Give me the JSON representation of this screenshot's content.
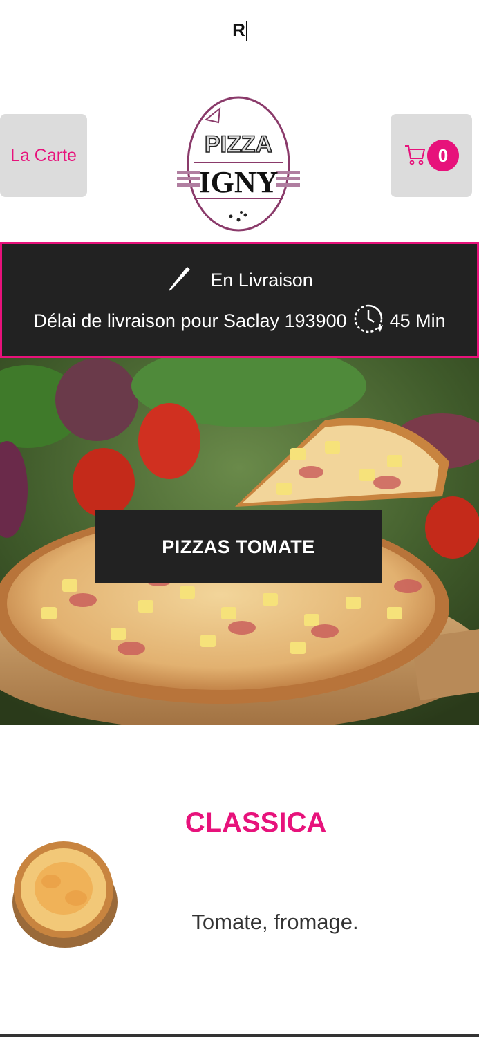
{
  "search": {
    "value": "R"
  },
  "header": {
    "carte_label": "La Carte",
    "cart_count": "0",
    "logo_text_top": "PIZZA",
    "logo_text_bottom": "IGNY"
  },
  "delivery": {
    "mode": "En Livraison",
    "delay_text": "Délai de livraison pour Saclay 193900",
    "delay_time": "45 Min"
  },
  "hero": {
    "cta_label": "PIZZAS TOMATE"
  },
  "product": {
    "name": "CLASSICA",
    "description": "Tomate, fromage."
  },
  "colors": {
    "accent": "#e7127b",
    "dark": "#222222",
    "button_bg": "#dcdcdc",
    "logo": "#8a3a6a"
  },
  "icons": [
    "cart-icon",
    "pencil-icon",
    "clock-icon"
  ]
}
